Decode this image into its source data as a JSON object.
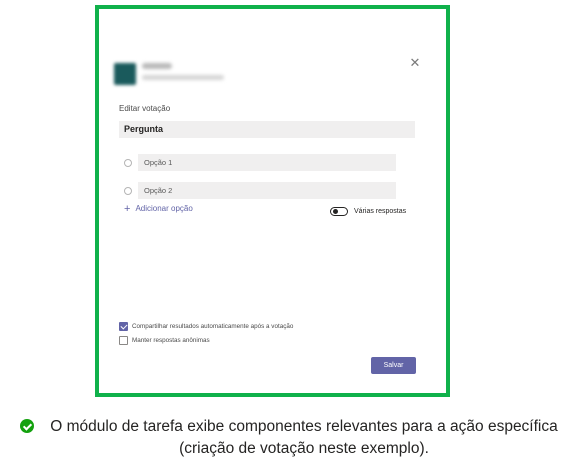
{
  "dialog": {
    "close_symbol": "✕",
    "heading": "Editar votação",
    "question_label": "Pergunta",
    "options": [
      {
        "label": "Opção 1"
      },
      {
        "label": "Opção 2"
      }
    ],
    "add_option_label": "Adicionar opção",
    "add_option_icon": "plus-icon",
    "multiple_responses_label": "Várias respostas",
    "multiple_responses_on": false,
    "share_results_label": "Compartilhar resultados automaticamente após a votação",
    "share_results_checked": true,
    "anonymous_label": "Manter respostas anônimas",
    "anonymous_checked": false,
    "save_label": "Salvar"
  },
  "caption": {
    "icon": "check-circle-icon",
    "text": "O módulo de tarefa exibe componentes relevantes para a ação específica (criação de votação neste exemplo)."
  },
  "colors": {
    "frame_border": "#10b14b",
    "accent": "#6264a7",
    "field_background": "#f0efef",
    "success_icon": "#13a10e"
  }
}
